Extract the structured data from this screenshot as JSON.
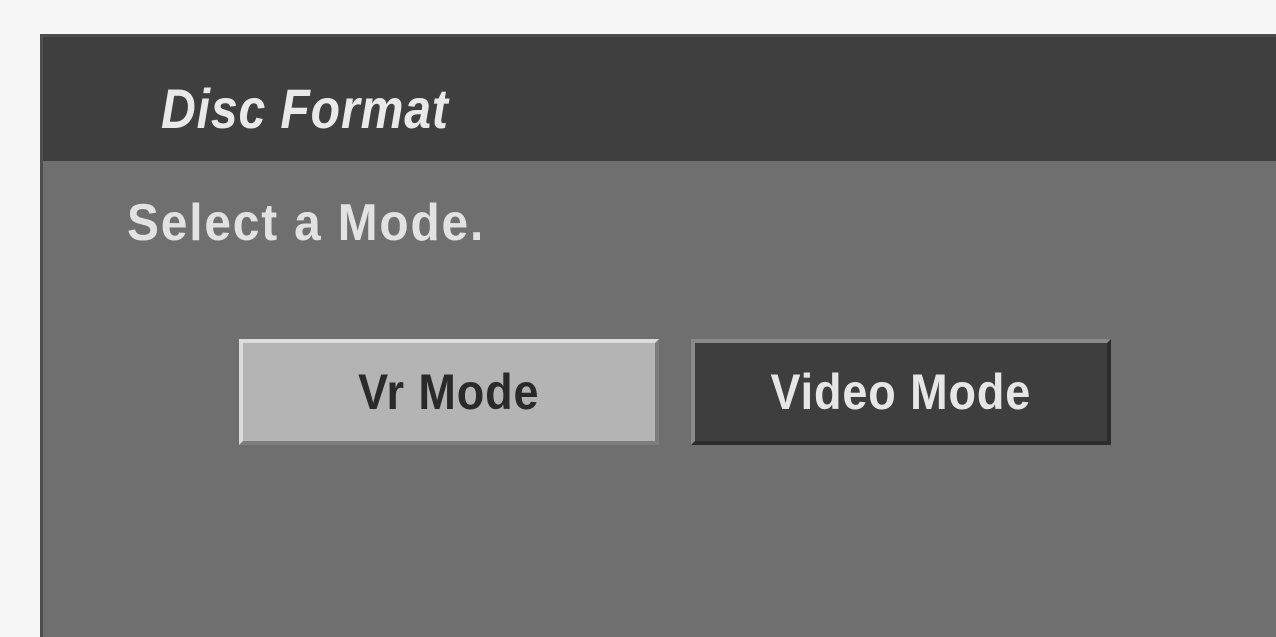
{
  "dialog": {
    "title": "Disc Format",
    "prompt": "Select a Mode."
  },
  "modes": {
    "vr_label": "Vr Mode",
    "video_label": "Video Mode",
    "selected": "Vr Mode"
  },
  "colors": {
    "title_bar": "#3f3f3f",
    "panel": "#6f6f6f",
    "selected_button": "#b4b4b4",
    "unselected_button": "#3e3e3e"
  }
}
